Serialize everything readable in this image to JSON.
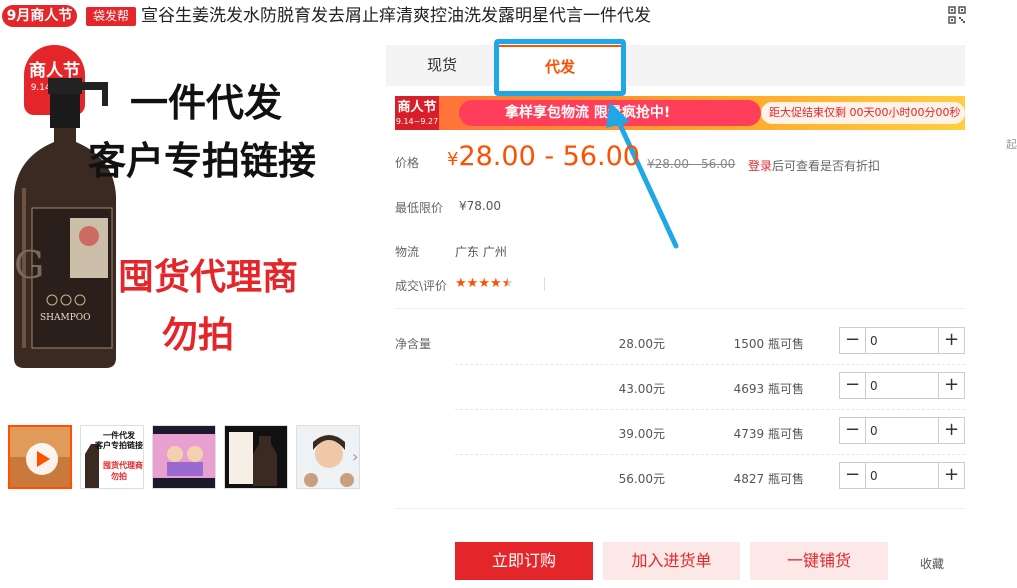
{
  "header": {
    "festival_badge": "9月商人节",
    "bag_badge": "袋发帮",
    "title": "宣谷生姜洗发水防脱育发去屑止痒清爽控油洗发露明星代言一件代发",
    "right_edge_text": "起"
  },
  "main_image": {
    "festival_tag": "商人节",
    "festival_dates": "9.14~9.27",
    "line1": "一件代发",
    "line2": "客户专拍链接",
    "red_line1": "囤货代理商",
    "red_line2": "勿拍",
    "bottle_brand": "G",
    "bottle_text": "SHAMPOO"
  },
  "thumbnails": {
    "thumb2_line1": "一件代发",
    "thumb2_line2": "客户专拍链接",
    "thumb2_red1": "囤货代理商",
    "thumb2_red2": "勿拍"
  },
  "tabs": [
    {
      "label": "现货"
    },
    {
      "label": "代发"
    }
  ],
  "banner": {
    "left_title": "商人节",
    "left_dates": "9.14~9.27",
    "pill_text": "拿样享包物流 限量疯抢中!",
    "countdown": "距大促结束仅剩 00天00小时00分00秒"
  },
  "price": {
    "label": "价格",
    "currency": "¥",
    "range": "28.00 - 56.00",
    "original": "¥28.00 - 56.00",
    "login_link": "登录",
    "login_tip": "后可查看是否有折扣"
  },
  "min_price": {
    "label": "最低限价",
    "value": "¥78.00"
  },
  "logistics": {
    "label": "物流",
    "value": "广东 广州"
  },
  "rating": {
    "label": "成交\\评价",
    "stars": 4.5
  },
  "sku": {
    "label": "净含量",
    "rows": [
      {
        "price": "28.00元",
        "stock": "1500 瓶可售",
        "qty": "0"
      },
      {
        "price": "43.00元",
        "stock": "4693 瓶可售",
        "qty": "0"
      },
      {
        "price": "39.00元",
        "stock": "4739 瓶可售",
        "qty": "0"
      },
      {
        "price": "56.00元",
        "stock": "4827 瓶可售",
        "qty": "0"
      }
    ]
  },
  "actions": {
    "buy": "立即订购",
    "add_cart": "加入进货单",
    "distribute": "一键铺货",
    "favorite": "收藏"
  },
  "colors": {
    "brand_red": "#e4262b",
    "price_orange": "#ff5000",
    "highlight_blue": "#1fa8e6"
  }
}
